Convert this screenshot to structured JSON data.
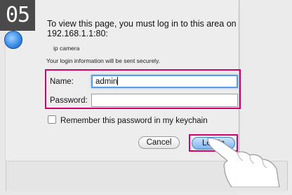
{
  "step": "05",
  "dialog": {
    "prompt": "To view this page, you must log in to this area on 192.168.1.1:80:",
    "realm": "ip camera",
    "secure_note": "Your login information will be sent securely.",
    "name_label": "Name:",
    "name_value": "admin",
    "password_label": "Password:",
    "password_value": "",
    "remember_label": "Remember this password in my keychain",
    "remember_checked": false,
    "cancel_label": "Cancel",
    "login_label": "Log In"
  },
  "colors": {
    "highlight": "#d1006a",
    "focus_ring": "#5c9ae8",
    "default_button": "#7fb3ef"
  },
  "icons": [
    "lock-icon",
    "pointing-hand-icon",
    "checkbox-icon"
  ]
}
